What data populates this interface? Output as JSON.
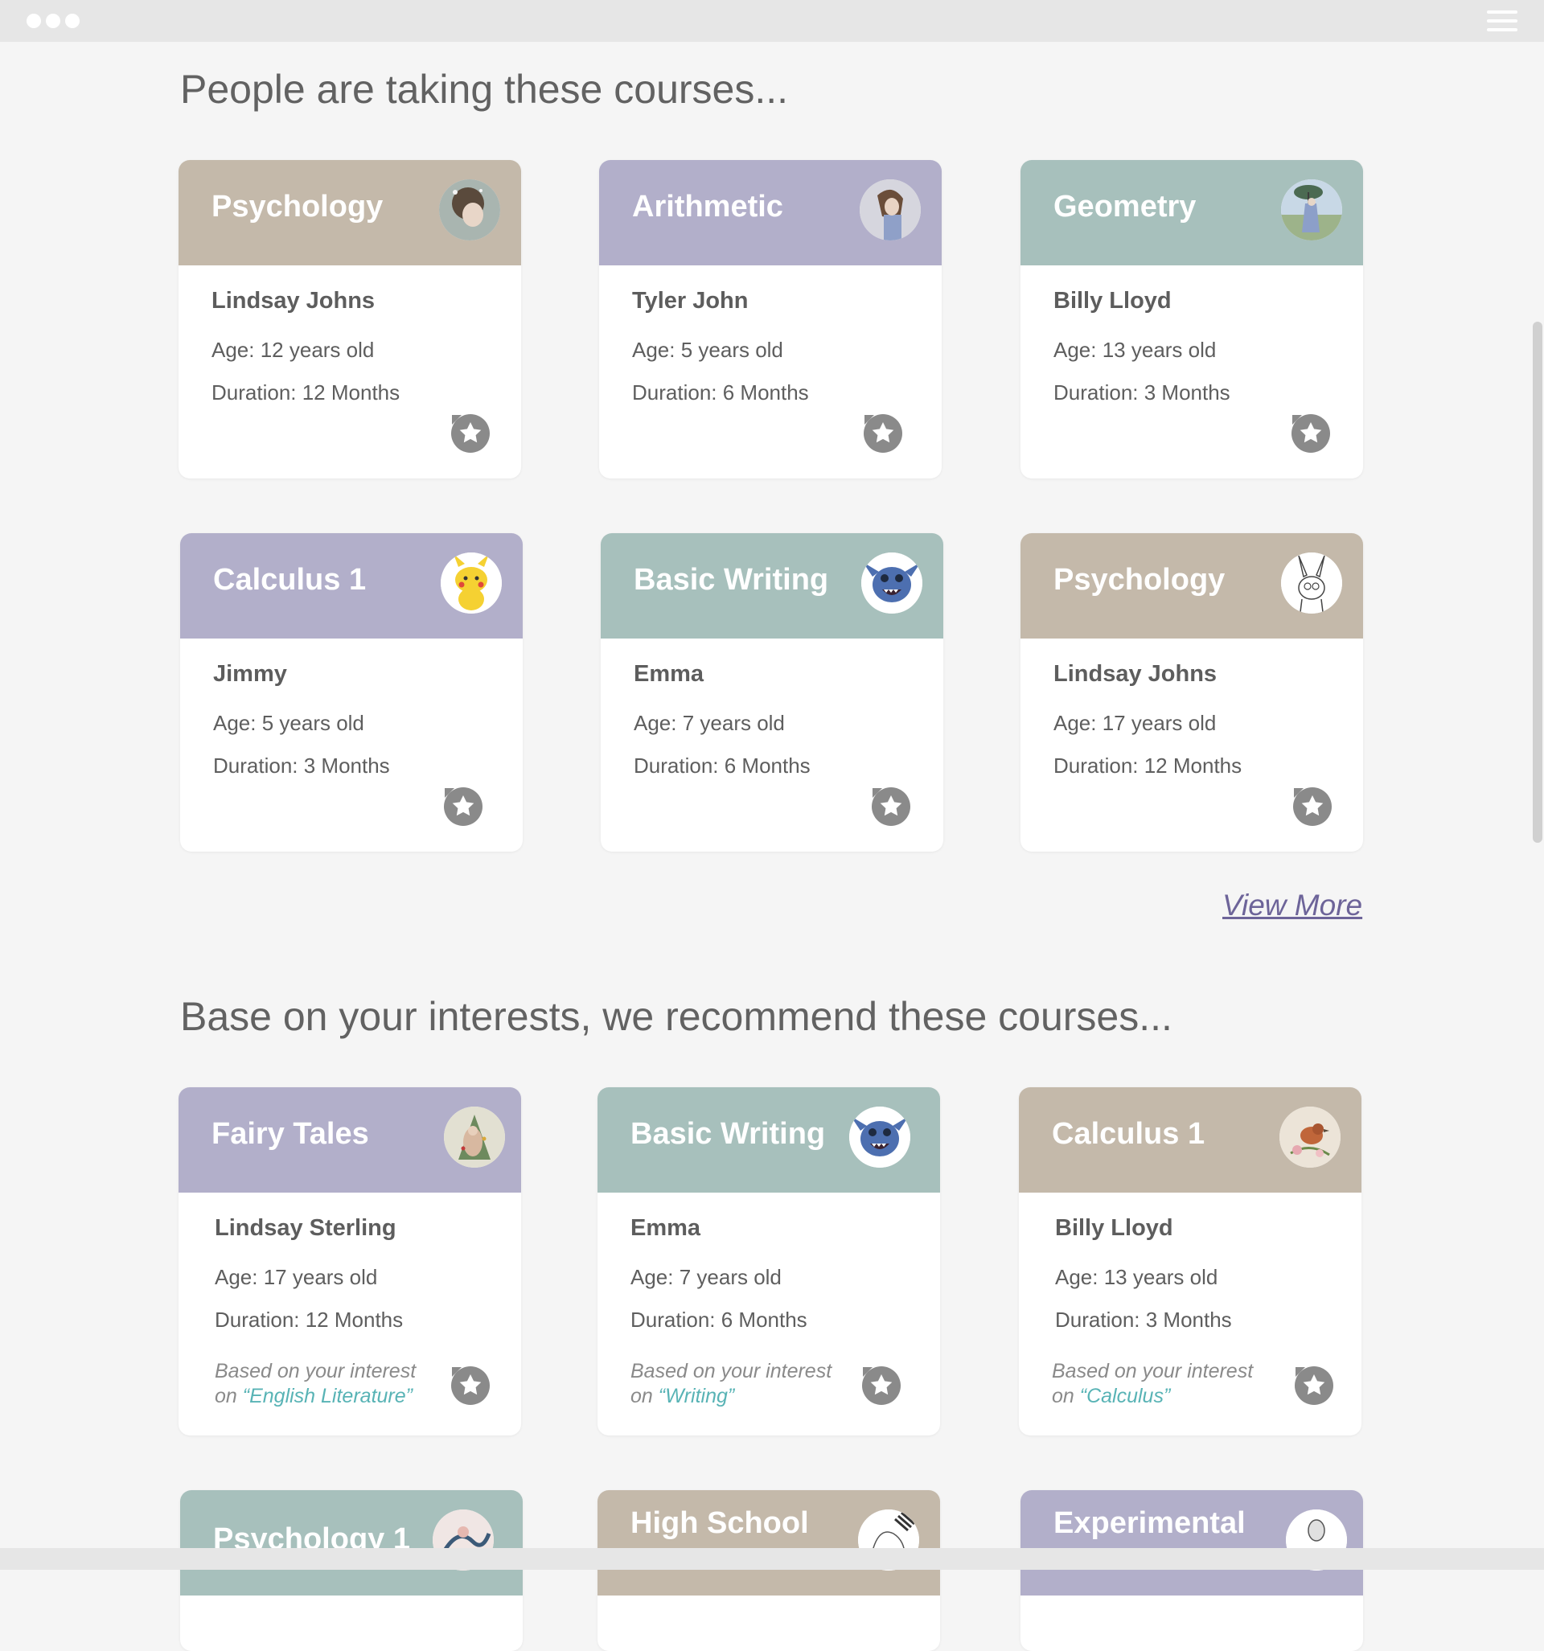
{
  "window": {
    "menu_icon": "hamburger-menu-icon"
  },
  "colors": {
    "beige": "#c4b9aa",
    "lavender": "#b2afca",
    "sage": "#a7c0bc",
    "link": "#6d6499",
    "keyword": "#58b3b5"
  },
  "section1": {
    "title": "People are taking these courses...",
    "cards": [
      {
        "course": "Psychology",
        "person": "Lindsay Johns",
        "age": "Age: 12 years old",
        "duration": "Duration: 12 Months"
      },
      {
        "course": "Arithmetic",
        "person": "Tyler John",
        "age": "Age: 5 years old",
        "duration": "Duration: 6 Months"
      },
      {
        "course": "Geometry",
        "person": "Billy Lloyd",
        "age": "Age: 13 years old",
        "duration": "Duration: 3 Months"
      },
      {
        "course": "Calculus 1",
        "person": "Jimmy",
        "age": "Age: 5 years old",
        "duration": "Duration: 3 Months"
      },
      {
        "course": "Basic Writing",
        "person": "Emma",
        "age": "Age: 7 years old",
        "duration": "Duration: 6 Months"
      },
      {
        "course": "Psychology",
        "person": "Lindsay Johns",
        "age": "Age: 17 years old",
        "duration": "Duration: 12 Months"
      }
    ],
    "view_more": "View More"
  },
  "section2": {
    "title": "Base on your interests, we recommend these courses...",
    "cards": [
      {
        "course": "Fairy Tales",
        "person": "Lindsay Sterling",
        "age": "Age: 17 years old",
        "duration": "Duration: 12 Months",
        "interest_prefix": "Based on your interest",
        "interest_on": "on",
        "interest_keyword": "“English Literature”"
      },
      {
        "course": "Basic Writing",
        "person": "Emma",
        "age": "Age: 7 years old",
        "duration": "Duration: 6 Months",
        "interest_prefix": "Based on your interest",
        "interest_on": "on",
        "interest_keyword": "“Writing”"
      },
      {
        "course": "Calculus 1",
        "person": "Billy Lloyd",
        "age": "Age: 13 years old",
        "duration": "Duration: 3 Months",
        "interest_prefix": "Based on your interest",
        "interest_on": "on",
        "interest_keyword": "“Calculus”"
      }
    ],
    "partial_cards": [
      {
        "course": "Psychology 1"
      },
      {
        "course": "High School"
      },
      {
        "course": "Experimental"
      }
    ]
  }
}
